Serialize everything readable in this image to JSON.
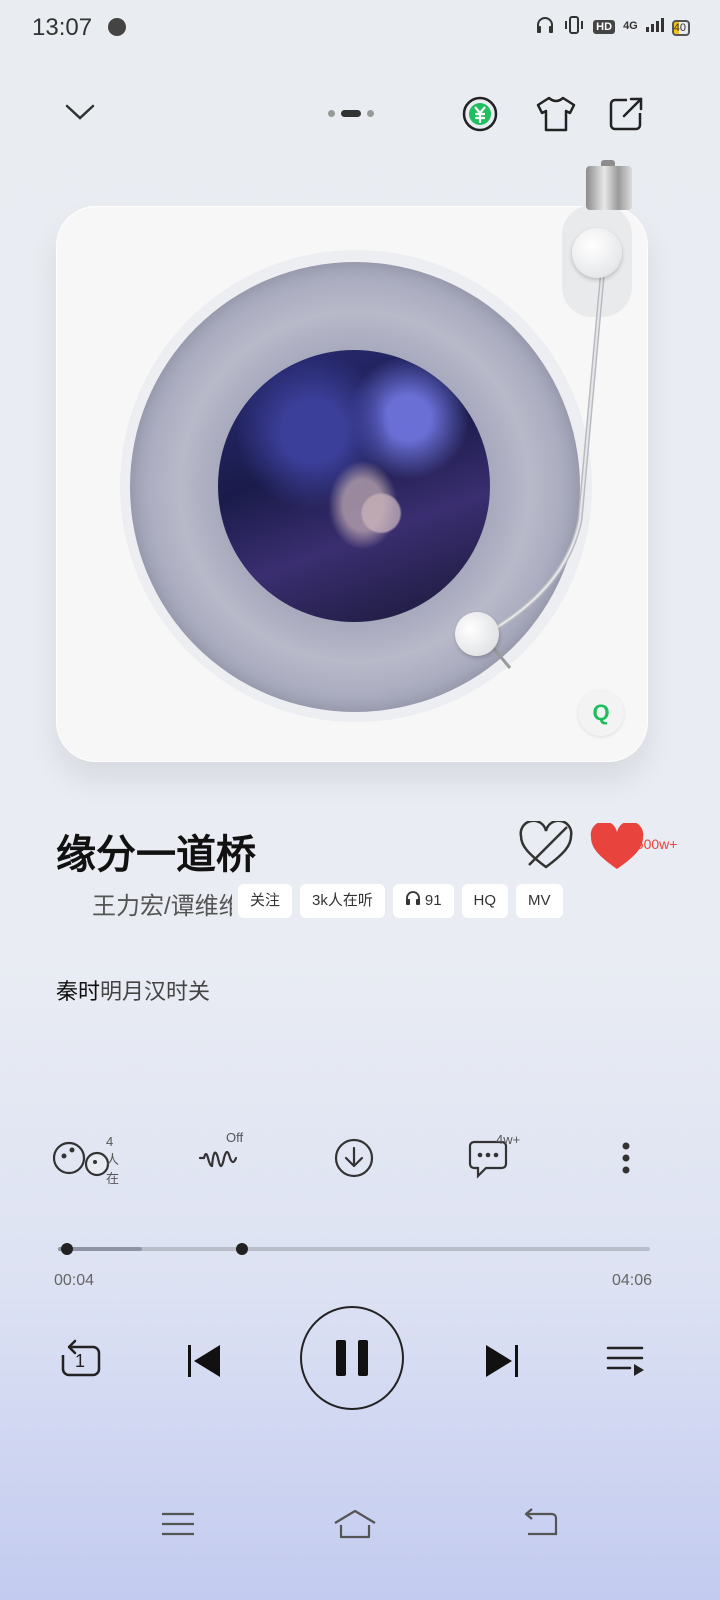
{
  "status_bar": {
    "time": "13:07",
    "network": "4G",
    "hd": "HD",
    "battery": "40"
  },
  "top_bar": {
    "collapse_icon": "chevron-down-icon",
    "vip_icon": "yuan-coin-icon",
    "theme_icon": "tshirt-icon",
    "share_icon": "share-icon",
    "page_dots": 3,
    "active_dot": 1,
    "vip_color": "#1fbf5d"
  },
  "song": {
    "title": "缘分一道桥",
    "artist": "王力宏/谭维维",
    "like_count": "1500w+",
    "like_color": "#e8443d",
    "tags": [
      {
        "label": "关注"
      },
      {
        "label": "3k人在听"
      },
      {
        "label": "91",
        "icon": "headphones-icon"
      },
      {
        "label": "HQ"
      },
      {
        "label": "MV"
      }
    ],
    "lyric_sung": "秦时",
    "lyric_rest": "明月汉时关"
  },
  "actions": {
    "listen_together": "4人在",
    "sound_effect": "Off",
    "comments": "4w+"
  },
  "progress": {
    "current": "00:04",
    "total": "04:06",
    "position_fraction": 0.016,
    "buffer_fraction": 0.142,
    "marker_fraction": 0.31
  },
  "controls": {
    "repeat_mode": "1",
    "playing": true
  },
  "logo": {
    "letter": "Q"
  }
}
